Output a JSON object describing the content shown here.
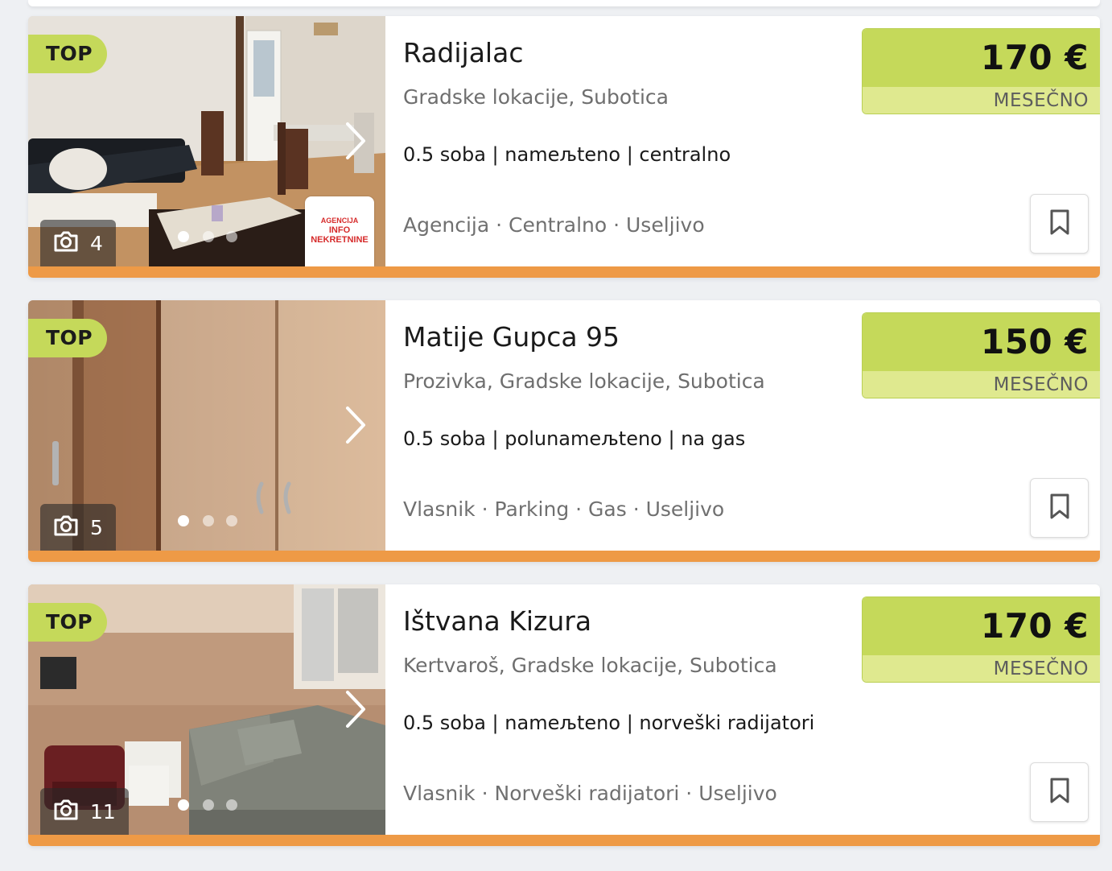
{
  "listings": [
    {
      "badge": "TOP",
      "photo_count": "4",
      "title": "Radijalac",
      "location": "Gradske lokacije, Subotica",
      "specs": "0.5 soba | nameљteno | centralno",
      "tags": "Agencija · Centralno · Useljivo",
      "price": "170 €",
      "period": "MESEČNO",
      "agency_logo": [
        "AGENCIJA",
        "INFO NEKRETNINE"
      ]
    },
    {
      "badge": "TOP",
      "photo_count": "5",
      "title": "Matije Gupca 95",
      "location": "Prozivka, Gradske lokacije, Subotica",
      "specs": "0.5 soba | polunameљteno | na gas",
      "tags": "Vlasnik · Parking · Gas · Useljivo",
      "price": "150 €",
      "period": "MESEČNO"
    },
    {
      "badge": "TOP",
      "photo_count": "11",
      "title": "Ištvana Kizura",
      "location": "Kertvaroš, Gradske lokacije, Subotica",
      "specs": "0.5 soba | nameљteno | norveški radijatori",
      "tags": "Vlasnik · Norveški radijatori · Useljivo",
      "price": "170 €",
      "period": "MESEČNO"
    }
  ],
  "colors": {
    "accent_green": "#c5d95a",
    "accent_green_light": "#dfe98f",
    "bottom_stripe": "#ee9a46",
    "agency_red": "#d62b2b"
  },
  "icons": [
    "camera-icon",
    "chevron-right-icon",
    "bookmark-icon"
  ]
}
